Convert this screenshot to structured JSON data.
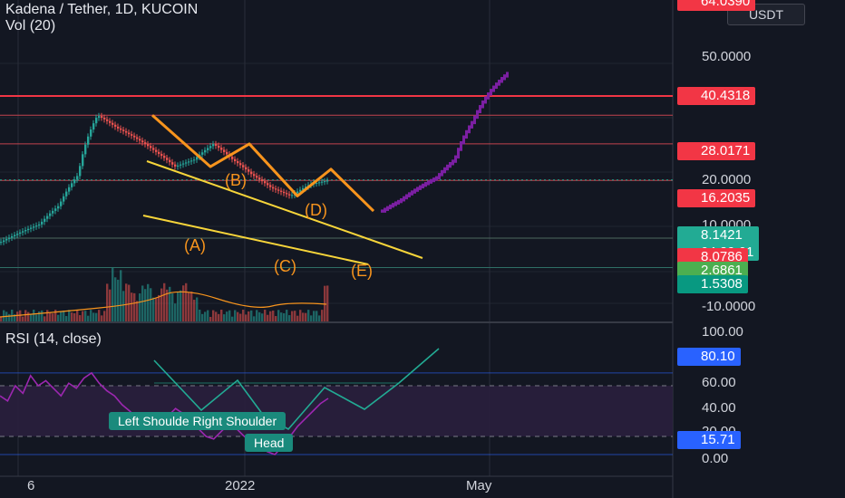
{
  "header": {
    "title": "Kadena / Tether, 1D, KUCOIN",
    "volume_label": "Vol (20)",
    "rsi_label": "RSI (14, close)"
  },
  "currency_button": "USDT",
  "price_tags": {
    "top_cut": "64.0390",
    "level_1": "40.4318",
    "level_2": "28.0171",
    "level_3": "16.2035",
    "current": "8.1421",
    "countdown": "04:29:01",
    "level_4": "8.0786",
    "level_5": "2.6861",
    "level_6": "1.5308",
    "rsi_high": "80.10",
    "rsi_low": "15.71"
  },
  "price_axis": [
    "50.0000",
    "20.0000",
    "10.0000",
    "-10.0000"
  ],
  "rsi_axis": [
    "100.00",
    "60.00",
    "40.00",
    "20.00",
    "0.00"
  ],
  "x_axis": {
    "left": "6",
    "mid": "2022",
    "right": "May"
  },
  "wave_labels": {
    "a": "(A)",
    "b": "(B)",
    "c": "(C)",
    "d": "(D)",
    "e": "(E)"
  },
  "rsi_annotations": {
    "shoulders": "Left Shoulde Right Shoulder",
    "head": "Head"
  },
  "colors": {
    "background": "#131722",
    "red_level": "#f23645",
    "green_tag": "#089981",
    "blue_tag": "#2962ff",
    "wave": "#f7941d",
    "trendline": "#f7d53a",
    "rsi": "#9c27b0",
    "pattern": "#22ab94",
    "projection": "#7b1fa2"
  },
  "chart_data": {
    "type": "candlestick",
    "symbol": "Kadena / Tether",
    "interval": "1D",
    "exchange": "KUCOIN",
    "horizontal_levels": [
      40.4318,
      28.0171,
      16.2035,
      8.0786,
      2.6861,
      1.5308
    ],
    "current_price": 8.1421,
    "wave_points": [
      {
        "label": "(A)",
        "price": 10.5
      },
      {
        "label": "(B)",
        "price": 16.2
      },
      {
        "label": "(C)",
        "price": 6.0
      },
      {
        "label": "(D)",
        "price": 10.0
      },
      {
        "label": "(E)",
        "price": 4.5
      }
    ],
    "price_path": [
      2.5,
      3.0,
      3.5,
      5.0,
      9.0,
      28.0,
      22.0,
      18.0,
      14.0,
      10.5,
      12.0,
      16.2,
      12.0,
      9.0,
      7.0,
      6.0,
      7.5,
      8.1
    ],
    "projection_path": [
      4.5,
      5.5,
      7.0,
      8.5,
      12.0,
      25.0,
      45.0,
      64.0
    ],
    "rsi": {
      "length": 14,
      "source": "close",
      "bands": [
        70,
        30
      ],
      "series": [
        62,
        58,
        70,
        64,
        78,
        70,
        74,
        68,
        62,
        72,
        68,
        76,
        80.1,
        72,
        66,
        62,
        55,
        50,
        44,
        40,
        36,
        40,
        46,
        52,
        48,
        42,
        36,
        30,
        28,
        34,
        40,
        36,
        30,
        26,
        22,
        18,
        15.71,
        22,
        30,
        38,
        44,
        50,
        56,
        60
      ],
      "pattern": "head and shoulders"
    }
  }
}
